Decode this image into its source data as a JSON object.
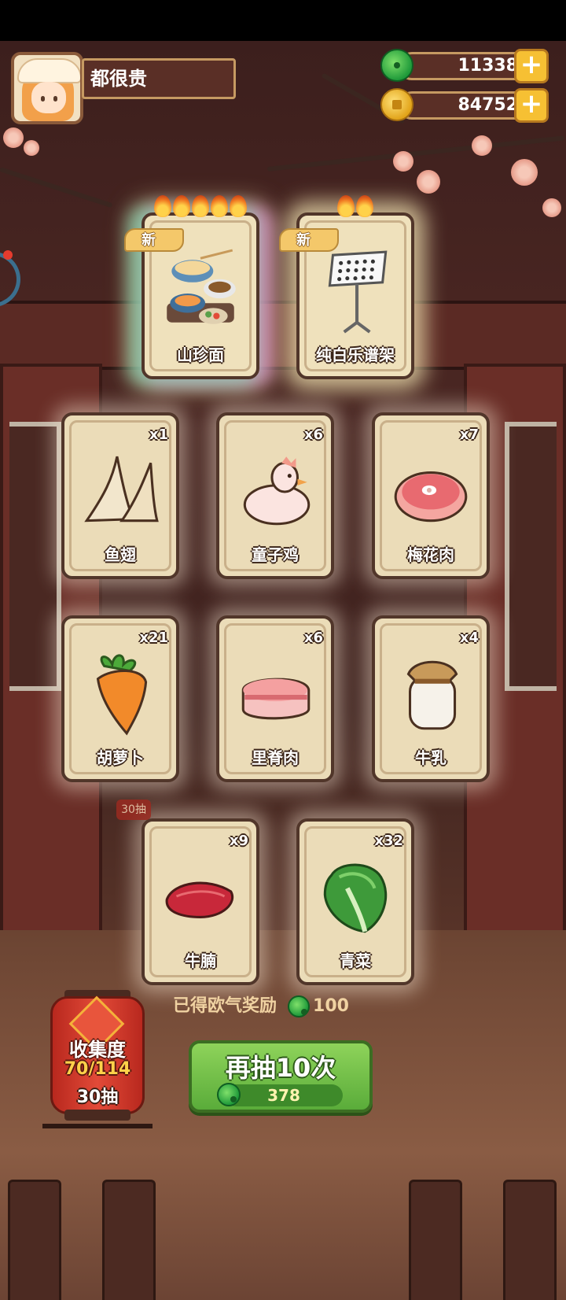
{
  "player": {
    "name": "都很贵"
  },
  "currency": {
    "jade": {
      "value": "11338",
      "icon": "jade-coin-icon",
      "plus": "+"
    },
    "gold": {
      "value": "84752",
      "icon": "gold-coin-icon",
      "plus": "+"
    }
  },
  "featured": [
    {
      "name": "山珍面",
      "badge": "新",
      "stars": 5,
      "icon": "noodle-feast-icon"
    },
    {
      "name": "纯白乐谱架",
      "badge": "新",
      "stars": 2,
      "icon": "music-stand-icon"
    }
  ],
  "cards": [
    {
      "name": "鱼翅",
      "qty": "x1",
      "icon": "shark-fin-icon"
    },
    {
      "name": "童子鸡",
      "qty": "x6",
      "icon": "chicken-icon"
    },
    {
      "name": "梅花肉",
      "qty": "x7",
      "icon": "pork-steak-icon"
    },
    {
      "name": "胡萝卜",
      "qty": "x21",
      "icon": "carrot-icon"
    },
    {
      "name": "里脊肉",
      "qty": "x6",
      "icon": "tenderloin-icon"
    },
    {
      "name": "牛乳",
      "qty": "x4",
      "icon": "milk-jar-icon"
    },
    {
      "name": "牛腩",
      "qty": "x9",
      "icon": "beef-brisket-icon"
    },
    {
      "name": "青菜",
      "qty": "x32",
      "icon": "bok-choy-icon"
    }
  ],
  "reward": {
    "label": "已得欧气奖励",
    "amount": "100"
  },
  "collection": {
    "label": "收集度",
    "progress": "70/114",
    "pulls": "30抽"
  },
  "background_badge": "30抽",
  "draw_button": {
    "label": "再抽10次",
    "cost": "378"
  },
  "colors": {
    "accent_green": "#5aac3a",
    "card_bg": "#ebdcb8",
    "lantern_red": "#e24a38",
    "currency_gold": "#f6c033"
  }
}
